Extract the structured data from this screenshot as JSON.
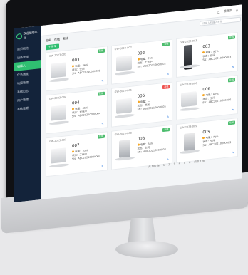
{
  "app": {
    "title": "欢迎使用平台"
  },
  "sidebar": {
    "items": [
      {
        "label": "首页概览"
      },
      {
        "label": "设备管理"
      },
      {
        "label": "机器人"
      },
      {
        "label": "任务调度"
      },
      {
        "label": "地图管理"
      },
      {
        "label": "系统日志"
      },
      {
        "label": "用户管理"
      },
      {
        "label": "系统设置"
      }
    ],
    "active_index": 2
  },
  "topbar": {
    "user": "管理员"
  },
  "search": {
    "placeholder": "请输入机器人名称"
  },
  "tabs": [
    {
      "label": "全部"
    },
    {
      "label": "在线"
    },
    {
      "label": "离线"
    }
  ],
  "add_button": "+ 新增",
  "cards": [
    {
      "code": "GW-2023-001",
      "name": "003",
      "status": "在线",
      "status_type": "ok",
      "info": [
        "电量：86%",
        "状态：空闲",
        "SN：ABC20210000001"
      ]
    },
    {
      "code": "GW-2023-002",
      "name": "002",
      "status": "在线",
      "status_type": "ok",
      "info": [
        "电量：75%",
        "状态：工作中",
        "SN：ABC20210000002"
      ]
    },
    {
      "code": "GW-2023-003",
      "name": "003",
      "status": "在线",
      "status_type": "ok",
      "info": [
        "电量：92%",
        "状态：空闲",
        "SN：ABC20210000003"
      ]
    },
    {
      "code": "GW-2023-004",
      "name": "004",
      "status": "在线",
      "status_type": "ok",
      "info": [
        "电量：45%",
        "状态：充电中",
        "SN：ABC20210000004"
      ]
    },
    {
      "code": "GW-2023-005",
      "name": "005",
      "status": "离线",
      "status_type": "err",
      "info": [
        "电量：—",
        "状态：离线",
        "SN：ABC20210000005"
      ]
    },
    {
      "code": "GW-2023-006",
      "name": "006",
      "status": "在线",
      "status_type": "ok",
      "info": [
        "电量：60%",
        "状态：空闲",
        "SN：ABC20210000006"
      ]
    },
    {
      "code": "GW-2023-007",
      "name": "007",
      "status": "在线",
      "status_type": "ok",
      "info": [
        "电量：33%",
        "状态：工作中",
        "SN：ABC20210000007"
      ]
    },
    {
      "code": "GW-2023-008",
      "name": "008",
      "status": "在线",
      "status_type": "ok",
      "info": [
        "电量：88%",
        "状态：空闲",
        "SN：ABC20210000008"
      ]
    },
    {
      "code": "GW-2023-009",
      "name": "009",
      "status": "在线",
      "status_type": "ok",
      "info": [
        "电量：71%",
        "状态：空闲",
        "SN：ABC20210000009"
      ]
    }
  ],
  "pagination": {
    "summary": "共 100 条",
    "pages": [
      "1",
      "2",
      "3",
      "4",
      "5",
      "6"
    ],
    "goto": "前往 1 页"
  }
}
